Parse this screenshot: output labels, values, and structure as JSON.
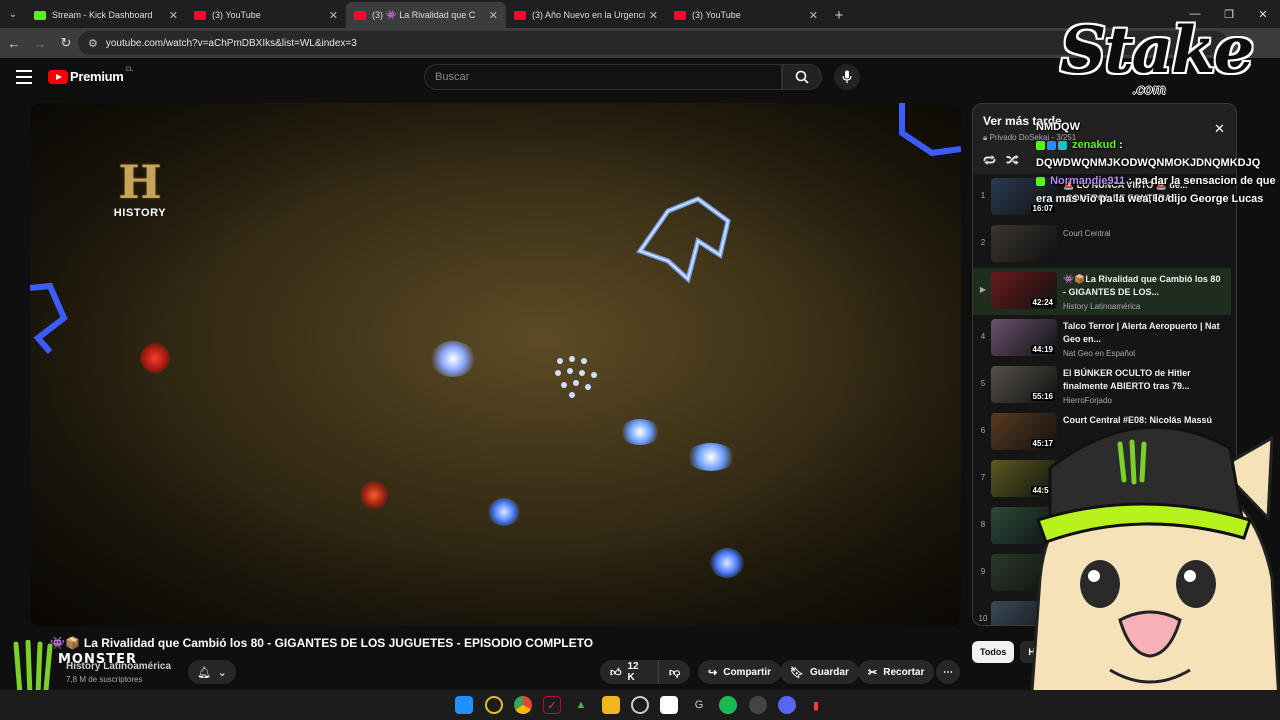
{
  "browser": {
    "tabs": [
      {
        "title": "Stream - Kick Dashboard",
        "favicon": "kick-icon",
        "active": false
      },
      {
        "title": "(3) YouTube",
        "favicon": "youtube-icon",
        "active": false
      },
      {
        "title": "(3) 👾 La Rivalidad que C",
        "favicon": "youtube-icon",
        "active": true
      },
      {
        "title": "(3) Año Nuevo en la Urgencia -",
        "favicon": "youtube-icon",
        "active": false
      },
      {
        "title": "(3) YouTube",
        "favicon": "youtube-icon",
        "active": false
      }
    ],
    "url": "youtube.com/watch?v=aChPmDBXIks&list=WL&index=3"
  },
  "yt": {
    "logo_text": "Premium",
    "region": "CL",
    "search_placeholder": "Buscar"
  },
  "video": {
    "history_logo_letter": "H",
    "history_logo_text": "HISTORY",
    "title": "La Rivalidad que Cambió los 80 - GIGANTES DE LOS JUGUETES - EPISODIO COMPLETO",
    "title_prefix": "👾📦",
    "channel": "History Latinoamérica",
    "subscribers": "7,8 M de suscriptores",
    "likes": "12 K",
    "share_label": "Compartir",
    "save_label": "Guardar",
    "clip_label": "Recortar",
    "more_label": "⋯"
  },
  "playlist": {
    "title": "Ver más tarde",
    "privacy": "Privado",
    "owner": "DoSekai",
    "position": "3/251",
    "items": [
      {
        "num": "1",
        "duration": "16:07",
        "title": "🚨 LO NUNCA VISTO 🚨 de... ¡CONTROL DE FONTERAS:...",
        "channel": "",
        "color": "#2a3a50",
        "active": false
      },
      {
        "num": "2",
        "duration": "",
        "title": "",
        "channel": "Court Central",
        "color": "#3a3530",
        "active": false
      },
      {
        "num": "▶",
        "duration": "42:24",
        "title": "👾📦La Rivalidad que Cambió los 80 - GIGANTES DE LOS...",
        "channel": "History Latinoamérica",
        "color": "#6a1a1a",
        "active": true
      },
      {
        "num": "4",
        "duration": "44:19",
        "title": "Talco Terror | Alerta Aeropuerto | Nat Geo en...",
        "channel": "Nat Geo en Español",
        "color": "#6a5070",
        "active": false
      },
      {
        "num": "5",
        "duration": "55:16",
        "title": "El BÚNKER OCULTO de Hitler finalmente ABIERTO tras 79...",
        "channel": "HierroForjado",
        "color": "#555048",
        "active": false
      },
      {
        "num": "6",
        "duration": "45:17",
        "title": "Court Central #E08: Nicolás Massú",
        "channel": "",
        "color": "#5a3a20",
        "active": false
      },
      {
        "num": "7",
        "duration": "44:50",
        "title": "",
        "channel": "",
        "color": "#5a5a20",
        "active": false
      },
      {
        "num": "8",
        "duration": "",
        "title": "",
        "channel": "",
        "color": "#2a4a3a",
        "active": false
      },
      {
        "num": "9",
        "duration": "",
        "title": "",
        "channel": "",
        "color": "#2a3a2a",
        "active": false
      },
      {
        "num": "10",
        "duration": "51",
        "title": "",
        "channel": "",
        "color": "#3a4a5a",
        "active": false
      }
    ]
  },
  "chips": {
    "all": "Todos",
    "second": "H"
  },
  "chat": {
    "header": "NMDQW",
    "messages": [
      {
        "user": "zenakud",
        "text": " : DQWDWQNMJKODWQNMOKJDNQMKDJQ"
      },
      {
        "user": "Normandie911",
        "text": " : pa dar la sensacion de que era mas vio pa la wea, lo dijo George Lucas"
      }
    ]
  },
  "overlay": {
    "stake_word": "Stake",
    "stake_com": ".com",
    "monster_word": "MONSTER"
  },
  "colors": {
    "youtube_red": "#ff0000",
    "kick_green": "#53fc18",
    "background": "#0f0f0f"
  },
  "taskbar_icons": [
    "windows-start-icon",
    "overwolf-icon",
    "chrome-icon",
    "vivaldi-icon",
    "app-icon",
    "file-explorer-icon",
    "obs-icon",
    "capcut-icon",
    "game-icon",
    "spotify-icon",
    "steam-icon",
    "discord-icon",
    "youtube-music-icon"
  ]
}
